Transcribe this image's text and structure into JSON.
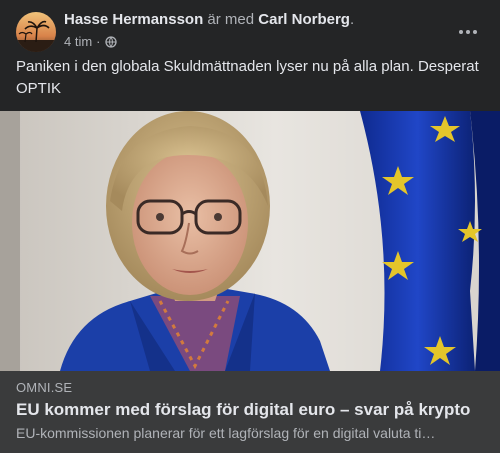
{
  "post": {
    "author": "Hasse Hermansson",
    "connector": " är med ",
    "tagged": "Carl Norberg",
    "period": ".",
    "time": "4 tim",
    "separator": "·",
    "privacy_icon": "globe-icon",
    "menu_icon": "more-options-icon",
    "text": "Paniken i den globala Skuldmättnaden lyser nu på alla plan. Desperat OPTIK"
  },
  "link": {
    "domain": "OMNI.SE",
    "title": "EU kommer med förslag för digital euro – svar på krypto",
    "description": "EU-kommissionen planerar för ett lagförslag för en digital valuta ti…"
  },
  "colors": {
    "background": "#242526",
    "link_background": "#3a3b3c",
    "primary_text": "#e4e6eb",
    "secondary_text": "#b0b3b8"
  }
}
